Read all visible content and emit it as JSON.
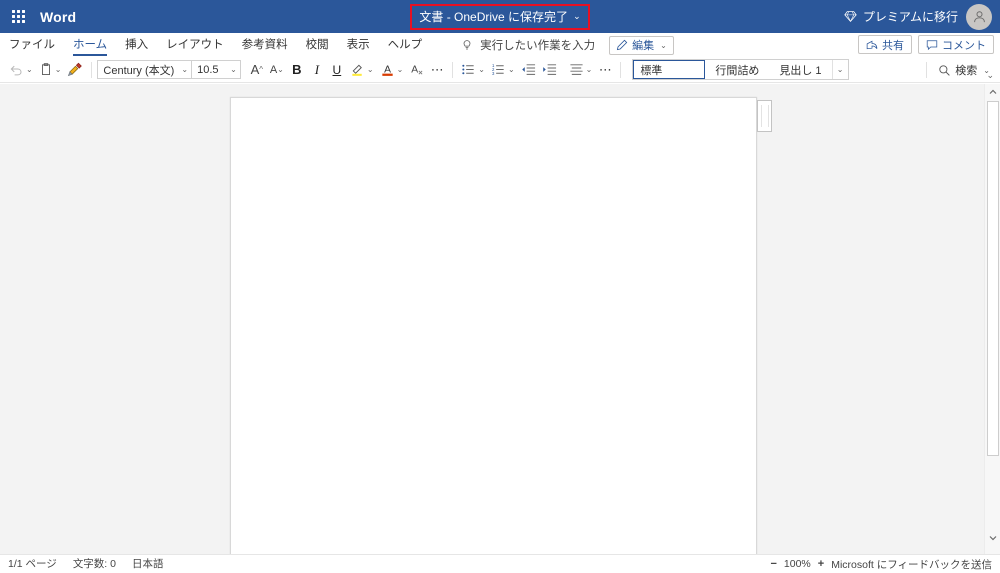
{
  "titlebar": {
    "waffle_label": "app-launcher",
    "app_name": "Word",
    "document_title": "文書 - OneDrive に保存完了",
    "title_chevron": "⌄",
    "highlight_color": "#e81123",
    "bar_color": "#2b579a",
    "premium_label": "プレミアムに移行",
    "avatar_initial": "◯"
  },
  "tabs": [
    {
      "label": "ファイル",
      "active": false
    },
    {
      "label": "ホーム",
      "active": true
    },
    {
      "label": "挿入",
      "active": false
    },
    {
      "label": "レイアウト",
      "active": false
    },
    {
      "label": "参考資料",
      "active": false
    },
    {
      "label": "校閲",
      "active": false
    },
    {
      "label": "表示",
      "active": false
    },
    {
      "label": "ヘルプ",
      "active": false
    }
  ],
  "tellme": {
    "placeholder": "実行したい作業を入力"
  },
  "edit_button": {
    "label": "編集",
    "chevron": "⌄"
  },
  "tabbar_right": {
    "share_label": "共有",
    "comments_label": "コメント"
  },
  "toolbar": {
    "undo_chevron": "⌄",
    "paste_chevron": "⌄",
    "font_name": "Century (本文)",
    "font_size": "10.5",
    "grow_font": "A",
    "shrink_font": "A",
    "bold": "B",
    "italic": "I",
    "underline": "U",
    "highlight_color": "#ffeb3b",
    "font_color": "#d83b01",
    "more_ellipsis": "⋯",
    "paragraph_ellipsis": "⋯",
    "chevron": "⌄"
  },
  "styles": {
    "items": [
      {
        "label": "標準",
        "selected": true
      },
      {
        "label": "行間詰め",
        "selected": false
      },
      {
        "label": "見出し 1",
        "selected": false
      }
    ],
    "more_chevron": "⌄"
  },
  "search": {
    "label": "検索",
    "chevron": "⌄"
  },
  "ribbon": {
    "collapse_chevron": "⌄"
  },
  "document": {
    "body_text": "",
    "page_count": 1
  },
  "statusbar": {
    "page_indicator": "1/1 ページ",
    "word_count": "文字数: 0",
    "language": "日本語",
    "zoom_out": "−",
    "zoom_level": "100%",
    "zoom_in": "+",
    "feedback": "Microsoft にフィードバックを送信"
  }
}
